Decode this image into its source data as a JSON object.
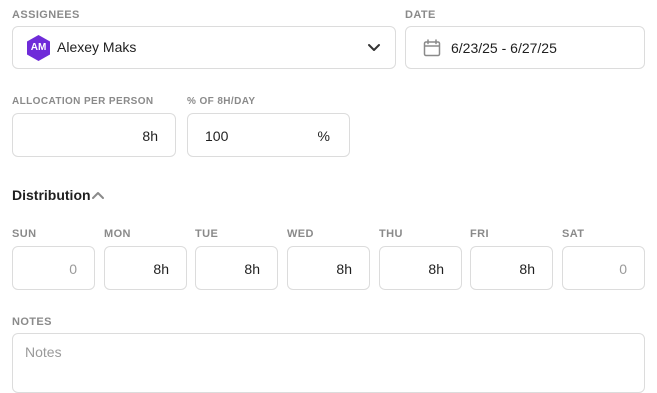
{
  "assignees": {
    "label": "ASSIGNEES",
    "initials": "AM",
    "name": "Alexey Maks",
    "avatar_color": "#6f2bd9"
  },
  "date": {
    "label": "DATE",
    "value": "6/23/25 - 6/27/25"
  },
  "allocation": {
    "label": "ALLOCATION PER PERSON",
    "value": "8h"
  },
  "percent": {
    "label": "% OF 8H/DAY",
    "value": "100",
    "unit": "%"
  },
  "distribution": {
    "title": "Distribution",
    "days": [
      {
        "label": "SUN",
        "value": "0"
      },
      {
        "label": "MON",
        "value": "8h"
      },
      {
        "label": "TUE",
        "value": "8h"
      },
      {
        "label": "WED",
        "value": "8h"
      },
      {
        "label": "THU",
        "value": "8h"
      },
      {
        "label": "FRI",
        "value": "8h"
      },
      {
        "label": "SAT",
        "value": "0"
      }
    ]
  },
  "notes": {
    "label": "NOTES",
    "placeholder": "Notes"
  }
}
